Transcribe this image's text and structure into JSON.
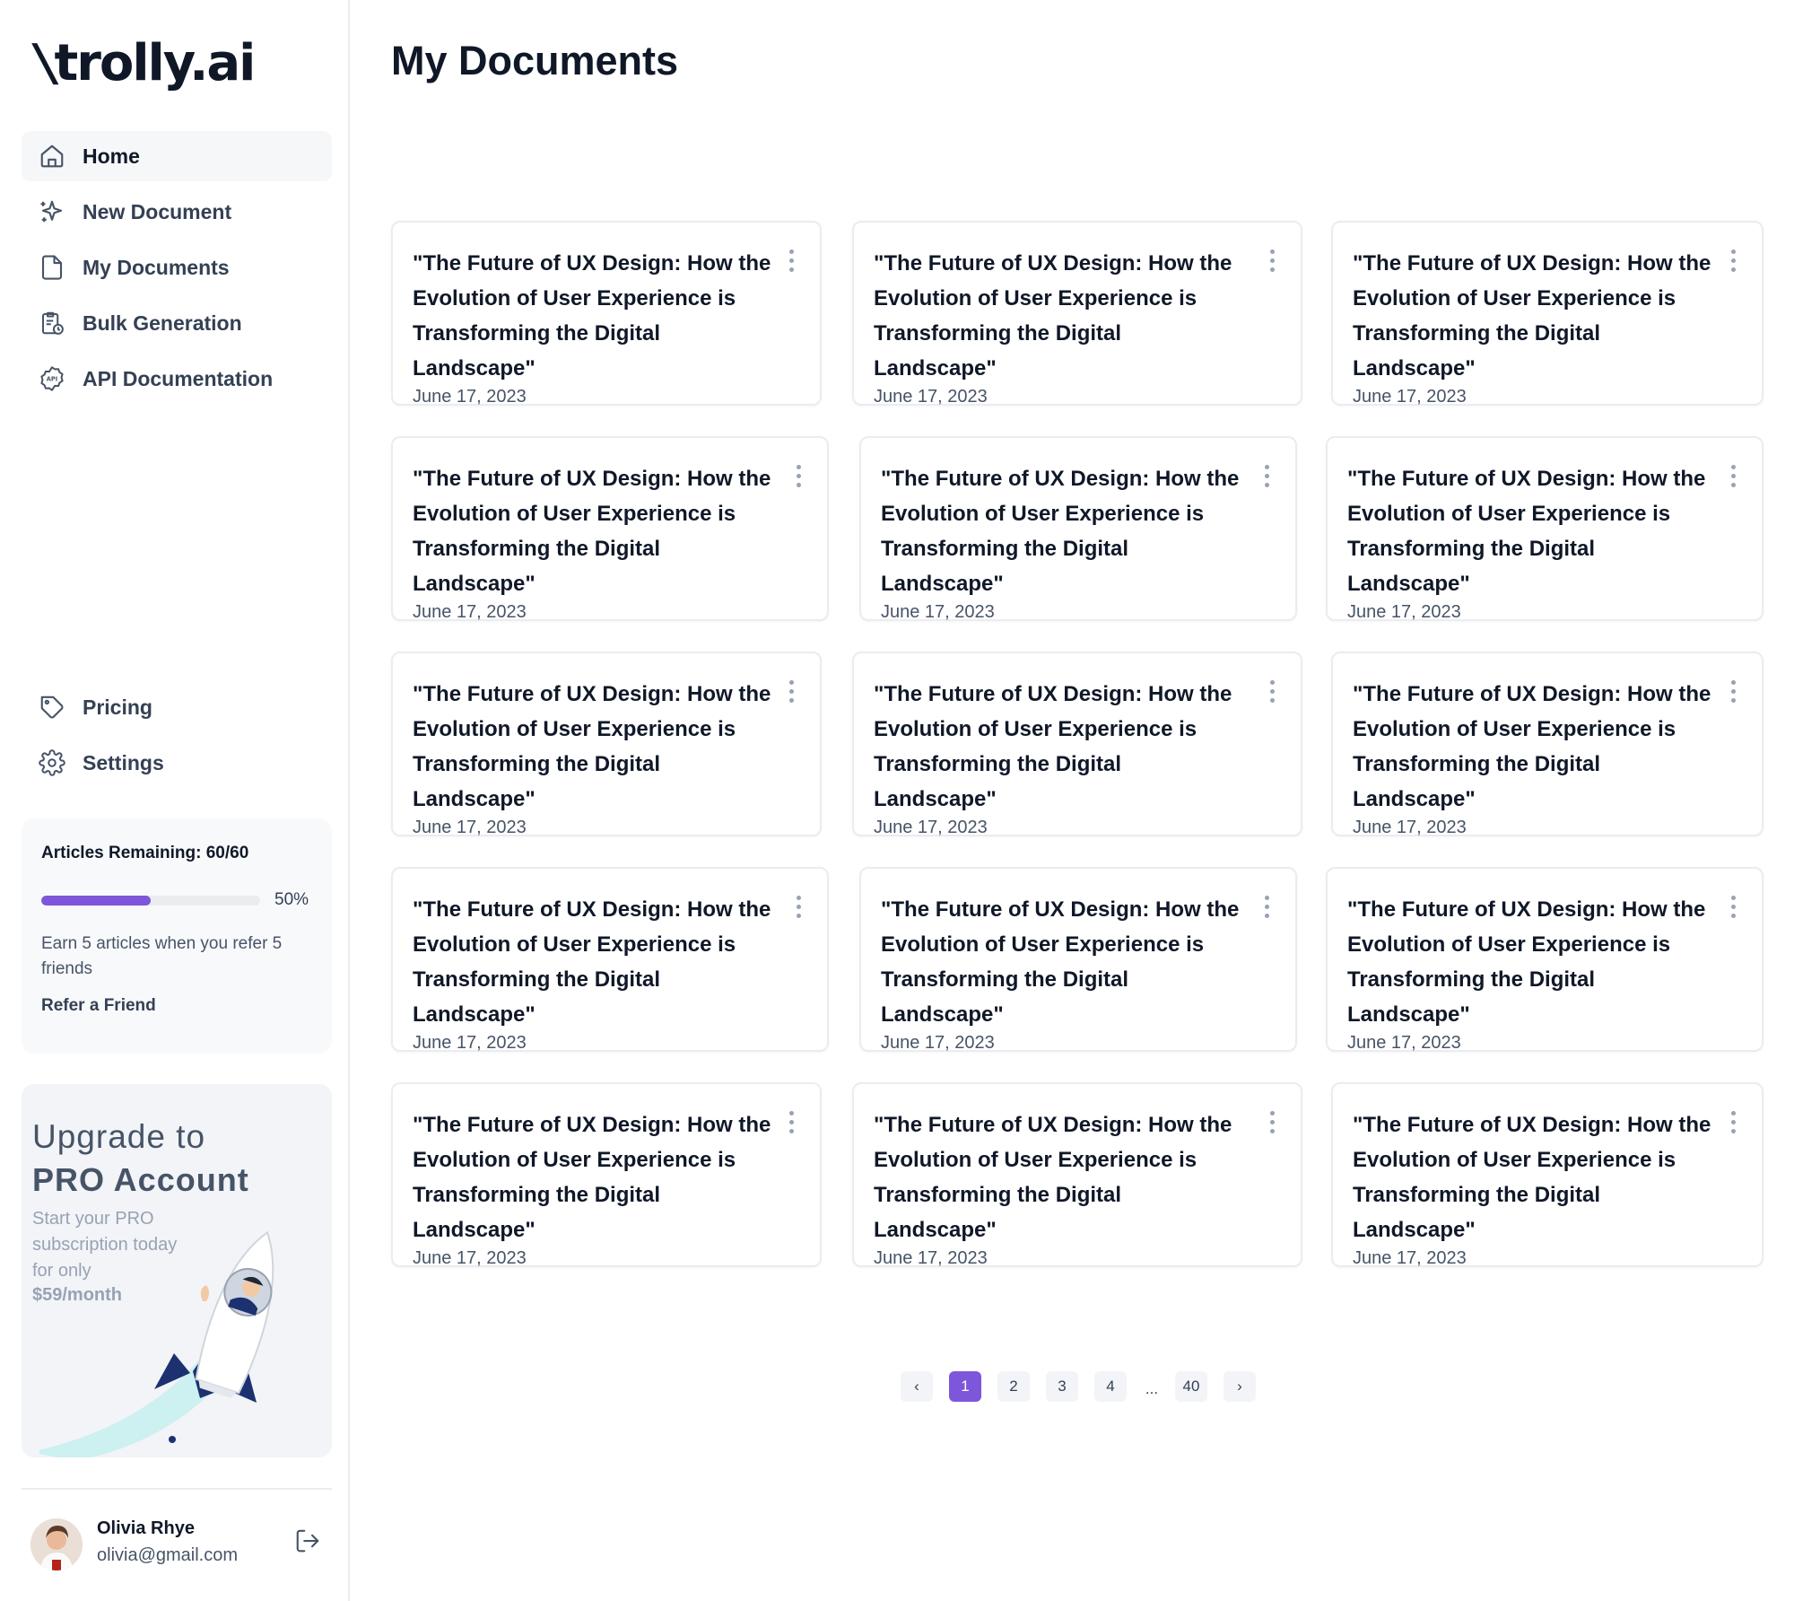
{
  "brand": {
    "logo_text": "trolly.ai",
    "accent_color": "#7e56d9"
  },
  "sidebar": {
    "nav_items": [
      {
        "label": "Home",
        "icon": "home-icon",
        "active": true
      },
      {
        "label": "New Document",
        "icon": "sparkle-icon",
        "active": false
      },
      {
        "label": "My Documents",
        "icon": "document-icon",
        "active": false
      },
      {
        "label": "Bulk Generation",
        "icon": "clipboard-clock-icon",
        "active": false
      },
      {
        "label": "API Documentation",
        "icon": "api-badge-icon",
        "active": false
      }
    ],
    "bottom_items": [
      {
        "label": "Pricing",
        "icon": "tag-icon"
      },
      {
        "label": "Settings",
        "icon": "gear-icon"
      }
    ],
    "usage": {
      "title": "Articles Remaining: 60/60",
      "percent_label": "50%",
      "progress": 0.5,
      "description": "Earn 5 articles when you refer 5 friends",
      "refer_label": "Refer a Friend"
    },
    "upgrade": {
      "line1": "Upgrade to",
      "line2": "PRO Account",
      "subtitle": "Start your PRO subscription today for only",
      "price": "$59/month"
    },
    "profile": {
      "name": "Olivia Rhye",
      "email": "olivia@gmail.com"
    }
  },
  "main": {
    "title": "My Documents",
    "documents": [
      {
        "title": "\"The Future of UX Design: How the Evolution of User Experience is Transforming the Digital Landscape\"",
        "date": "June 17, 2023"
      },
      {
        "title": "\"The Future of UX Design: How the Evolution of User Experience is Transforming the Digital Landscape\"",
        "date": "June 17, 2023"
      },
      {
        "title": "\"The Future of UX Design: How the Evolution of User Experience is Transforming the Digital Landscape\"",
        "date": "June 17, 2023"
      },
      {
        "title": "\"The Future of UX Design: How the Evolution of User Experience is Transforming the Digital Landscape\"",
        "date": "June 17, 2023"
      },
      {
        "title": "\"The Future of UX Design: How the Evolution of User Experience is Transforming the Digital Landscape\"",
        "date": "June 17, 2023"
      },
      {
        "title": "\"The Future of UX Design: How the Evolution of User Experience is Transforming the Digital Landscape\"",
        "date": "June 17, 2023"
      },
      {
        "title": "\"The Future of UX Design: How the Evolution of User Experience is Transforming the Digital Landscape\"",
        "date": "June 17, 2023"
      },
      {
        "title": "\"The Future of UX Design: How the Evolution of User Experience is Transforming the Digital Landscape\"",
        "date": "June 17, 2023"
      },
      {
        "title": "\"The Future of UX Design: How the Evolution of User Experience is Transforming the Digital Landscape\"",
        "date": "June 17, 2023"
      },
      {
        "title": "\"The Future of UX Design: How the Evolution of User Experience is Transforming the Digital Landscape\"",
        "date": "June 17, 2023"
      },
      {
        "title": "\"The Future of UX Design: How the Evolution of User Experience is Transforming the Digital Landscape\"",
        "date": "June 17, 2023"
      },
      {
        "title": "\"The Future of UX Design: How the Evolution of User Experience is Transforming the Digital Landscape\"",
        "date": "June 17, 2023"
      },
      {
        "title": "\"The Future of UX Design: How the Evolution of User Experience is Transforming the Digital Landscape\"",
        "date": "June 17, 2023"
      },
      {
        "title": "\"The Future of UX Design: How the Evolution of User Experience is Transforming the Digital Landscape\"",
        "date": "June 17, 2023"
      },
      {
        "title": "\"The Future of UX Design: How the Evolution of User Experience is Transforming the Digital Landscape\"",
        "date": "June 17, 2023"
      }
    ],
    "pagination": {
      "prev_label": "‹",
      "next_label": "›",
      "pages": [
        "1",
        "2",
        "3",
        "4"
      ],
      "ellipsis": "...",
      "last_page": "40",
      "current": "1"
    }
  }
}
